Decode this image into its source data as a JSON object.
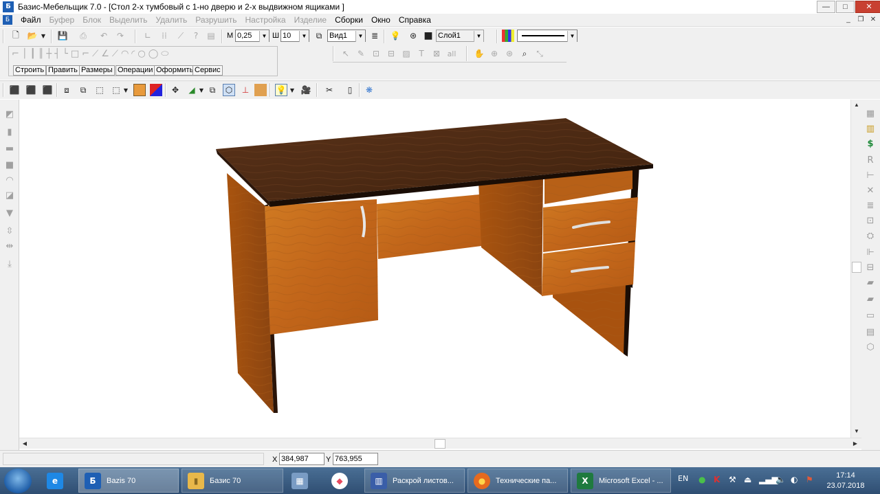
{
  "window": {
    "title": "Базис-Мебельщик 7.0 - [Стол 2-х тумбовый с 1-но дверю и 2-х выдвижном ящиками ]",
    "app_icon": "Б",
    "controls": {
      "minimize": "—",
      "maximize": "□",
      "close": "✕"
    }
  },
  "menu": {
    "items": [
      {
        "label": "Файл",
        "enabled": true
      },
      {
        "label": "Буфер",
        "enabled": false
      },
      {
        "label": "Блок",
        "enabled": false
      },
      {
        "label": "Выделить",
        "enabled": false
      },
      {
        "label": "Удалить",
        "enabled": false
      },
      {
        "label": "Разрушить",
        "enabled": false
      },
      {
        "label": "Настройка",
        "enabled": false
      },
      {
        "label": "Изделие",
        "enabled": false
      },
      {
        "label": "Сборки",
        "enabled": true
      },
      {
        "label": "Окно",
        "enabled": true
      },
      {
        "label": "Справка",
        "enabled": true
      }
    ],
    "mdi": {
      "minimize": "_",
      "restore": "❐",
      "close": "✕"
    }
  },
  "toolbar": {
    "m_label": "М",
    "m_value": "0,25",
    "sh_label": "Ш",
    "sh_value": "10",
    "view_value": "Вид1",
    "layer_value": "Слой1"
  },
  "sketch_tabs": [
    "Строить",
    "Править",
    "Размеры",
    "Операции",
    "Оформить",
    "Сервис"
  ],
  "status": {
    "x_label": "X",
    "x_value": "384,987",
    "y_label": "Y",
    "y_value": "763,955"
  },
  "taskbar": {
    "apps": [
      {
        "label": "",
        "icon": "e",
        "color": "#1e88e5"
      },
      {
        "label": "Bazis 70",
        "icon": "Б",
        "color": "#1e5fb4"
      },
      {
        "label": "Базис 70",
        "icon": "▮",
        "color": "#e8b84a"
      },
      {
        "label": "",
        "icon": "▦",
        "color": "#7a9cc4"
      },
      {
        "label": "",
        "icon": "◆",
        "color": "#e84a5f"
      },
      {
        "label": "Раскрой листов...",
        "icon": "▥",
        "color": "#3a5ea8"
      },
      {
        "label": "Технические па...",
        "icon": "●",
        "color": "#e66a1f"
      },
      {
        "label": "Microsoft Excel - ...",
        "icon": "X",
        "color": "#1f7a3f"
      }
    ],
    "lang": "EN",
    "time": "17:14",
    "date": "23.07.2018"
  },
  "colors": {
    "tabletop": "#4a2914",
    "wood": "#c96f1c",
    "wood_dark": "#8a4510",
    "edge": "#1a0d05",
    "handle": "#d8d8d8"
  }
}
